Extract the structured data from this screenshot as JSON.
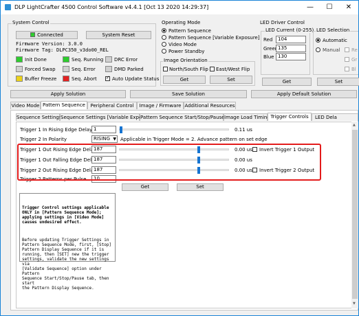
{
  "window": {
    "title": "DLP LightCrafter 4500 Control Software v4.4.1 [Oct 13 2020 14:29:37]"
  },
  "system_control": {
    "title": "System Control",
    "connected": "Connected",
    "system_reset": "System Reset",
    "firmware_version": "Firmware Version: 3.0.0",
    "firmware_tag": "Firmware Tag: DLPC350_v3do00_REL",
    "leds": [
      {
        "label": "Init Done",
        "color": "#2ecc2e"
      },
      {
        "label": "Seq. Running",
        "color": "#2ecc2e"
      },
      {
        "label": "DRC Error",
        "color": "#d0d0d0"
      },
      {
        "label": "Forced Swap",
        "color": "#d0d0d0"
      },
      {
        "label": "Seq. Error",
        "color": "#d0d0d0"
      },
      {
        "label": "DMD Parked",
        "color": "#d0d0d0"
      },
      {
        "label": "Buffer Freeze",
        "color": "#ecd21a"
      },
      {
        "label": "Seq. Abort",
        "color": "#e22222"
      }
    ],
    "auto_update": "Auto Update Status"
  },
  "operating_mode": {
    "title": "Operating Mode",
    "options": [
      "Pattern Sequence",
      "Pattern Sequence [Variable Exposure]",
      "Video Mode",
      "Power Standby"
    ],
    "selected": 0
  },
  "image_orientation": {
    "title": "Image Orientation",
    "north_south": "North/South Flip",
    "east_west": "East/West Flip",
    "get": "Get",
    "set": "Set"
  },
  "led_driver": {
    "title": "LED Driver Control",
    "current_title": "LED Current (0-255)",
    "red_label": "Red",
    "red_value": "104",
    "green_label": "Green",
    "green_value": "135",
    "blue_label": "Blue",
    "blue_value": "130",
    "selection_title": "LED Selection",
    "automatic": "Automatic",
    "manual": "Manual",
    "side_labels": [
      "Re",
      "Gr",
      "Bl"
    ],
    "get": "Get",
    "set": "Set"
  },
  "solutions": {
    "apply": "Apply Solution",
    "save": "Save Solution",
    "apply_default": "Apply Default Solution"
  },
  "main_tabs": [
    "Video Mode",
    "Pattern Sequence",
    "Peripheral Control",
    "Image / Firmware",
    "Additional Resources"
  ],
  "sub_tabs": [
    "Sequence Settings",
    "Sequence Settings [Variable Exposure]",
    "Pattern Sequence Start/Stop/Pause",
    "Image Load Timing",
    "Trigger Controls",
    "LED Dela"
  ],
  "trigger": {
    "t1_in_label": "Trigger 1 In Rising Edge Delay",
    "t1_in_value": "1",
    "t1_in_unit": "0.11 us",
    "t2_pol_label": "Trigger 2 In Polarity",
    "t2_pol_value": "RISING",
    "t2_pol_note": "Applicable in Trigger Mode = 2. Advance pattern on set edge",
    "rows": [
      {
        "label": "Trigger 1 Out Rising Edge Delay",
        "value": "187",
        "unit": "0.00 us",
        "slider_fraction": 0.5,
        "invert": "Invert Trigger 1 Output"
      },
      {
        "label": "Trigger 1 Out Falling Edge Delay",
        "value": "187",
        "unit": "0.00 us",
        "slider_fraction": 0.5
      },
      {
        "label": "Trigger 2 Out Rising Edge Delay",
        "value": "187",
        "unit": "0.00 us",
        "slider_fraction": 0.5,
        "invert": "Invert Trigger 2 Output"
      }
    ],
    "ppp_label": "Trigger 2 Patterns per Pulse",
    "ppp_value": "10",
    "get": "Get",
    "set": "Set"
  },
  "note": {
    "bold": "Trigger Control settings applicable\nONLY in [Pattern Sequence Mode];\napplying settings in [Video Mode]\ncauses undesired effect.",
    "body": "Before updating Trigger Settings in\nPattern Sequence Mode, first, [Stop]\nPattern Display Sequence if it is\nrunning, then [SET] new the trigger\nsettings, validate the new settings via\n[Validate Sequence] option under Pattern\nSequence Start/Stop/Pause tab, then start\nthe Pattern Display Sequence."
  }
}
